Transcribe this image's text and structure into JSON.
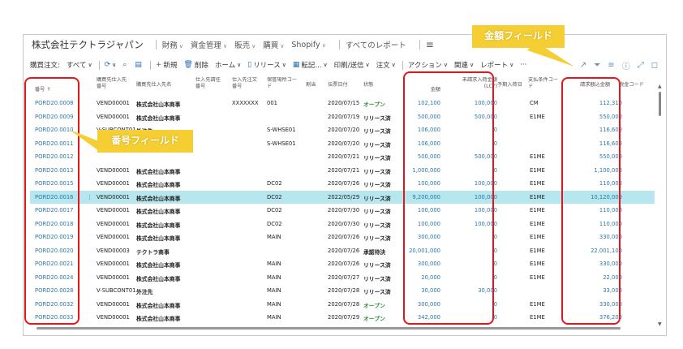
{
  "header": {
    "company": "株式会社テクトラジャパン",
    "nav": [
      {
        "label": "財務",
        "chev": true
      },
      {
        "label": "資金管理",
        "chev": true
      },
      {
        "label": "販売",
        "chev": true
      },
      {
        "label": "購買",
        "chev": true
      },
      {
        "label": "Shopify",
        "chev": true
      }
    ],
    "all_reports": "すべてのレポート",
    "menu_icon": "hamburger-icon"
  },
  "toolbar": {
    "title": "購買注文:",
    "filter": "すべて",
    "new": "新規",
    "delete": "削除",
    "home": "ホーム",
    "release": "リリース",
    "post": "転記...",
    "print": "印刷/送信",
    "order": "注文",
    "action": "アクション",
    "related": "関連",
    "report": "レポート",
    "more": "···"
  },
  "columns": {
    "no": "番号 ↑",
    "vendor_no": "購買先仕入先\n番号",
    "vendor_name": "購買先仕入先名",
    "pay_vendor_no": "仕入先請任\n番号",
    "vendor_order_no": "仕入先注文\n番号",
    "location": "保管場所コー\nド",
    "assign": "割当",
    "doc_date": "伝票日付",
    "status": "状態",
    "amount": "金額",
    "amount_lcy": "未請求入荷金額\n(LCY)",
    "receipt_date": "予期入荷日",
    "payment_terms": "支払条件コー\nド",
    "invoice_amount": "請求額込金額",
    "tax_code": "税金コード"
  },
  "rows": [
    {
      "no": "PORD20.0008",
      "vendor_no": "VEND00001",
      "vendor_name": "株式会社山本商事",
      "vendor_order_no": "XXXXXXX",
      "location": "001",
      "date": "2020/07/15",
      "status": "オープン",
      "status_type": "open",
      "amount": "102,100",
      "lcy": "100,000",
      "terms": "CM",
      "inv": "112,310"
    },
    {
      "no": "PORD20.0009",
      "vendor_no": "VEND00001",
      "vendor_name": "株式会社山本商事",
      "vendor_order_no": "",
      "location": "",
      "date": "2020/07/19",
      "status": "リリース済",
      "status_type": "rel",
      "amount": "500,000",
      "lcy": "500,000",
      "terms": "E1ME",
      "inv": "550,000"
    },
    {
      "no": "PORD20.0010",
      "vendor_no": "V-SUBCONT01",
      "vendor_name": "外注先",
      "vendor_order_no": "",
      "location": "S-WHSE01",
      "date": "2020/07/20",
      "status": "リリース済",
      "status_type": "rel",
      "amount": "106,000",
      "lcy": "0",
      "terms": "",
      "inv": "116,600"
    },
    {
      "no": "PORD20.0011",
      "vendor_no": "",
      "vendor_name": "",
      "vendor_order_no": "",
      "location": "S-WHSE01",
      "date": "2020/07/20",
      "status": "リリース済",
      "status_type": "rel",
      "amount": "106,000",
      "lcy": "0",
      "terms": "",
      "inv": "116,600"
    },
    {
      "no": "PORD20.0012",
      "vendor_no": "",
      "vendor_name": "",
      "vendor_order_no": "",
      "location": "",
      "date": "2020/07/21",
      "status": "リリース済",
      "status_type": "rel",
      "amount": "500,000",
      "lcy": "500,000",
      "terms": "E1ME",
      "inv": "550,000"
    },
    {
      "no": "PORD20.0013",
      "vendor_no": "VEND00001",
      "vendor_name": "株式会社山本商事",
      "vendor_order_no": "",
      "location": "",
      "date": "2020/07/21",
      "status": "リリース済",
      "status_type": "rel",
      "amount": "1,000,000",
      "lcy": "0",
      "terms": "E1ME",
      "inv": "1,100,000"
    },
    {
      "no": "PORD20.0015",
      "vendor_no": "VEND00001",
      "vendor_name": "株式会社山本商事",
      "vendor_order_no": "",
      "location": "DC02",
      "date": "2020/07/26",
      "status": "リリース済",
      "status_type": "rel",
      "amount": "100,000",
      "lcy": "100,000",
      "terms": "E1ME",
      "inv": "110,000"
    },
    {
      "no": "PORD20.0016",
      "vendor_no": "VEND00001",
      "vendor_name": "株式会社山本商事",
      "vendor_order_no": "",
      "location": "DC02",
      "date": "2022/05/29",
      "status": "リリース済",
      "status_type": "rel",
      "amount": "9,200,000",
      "lcy": "100,000",
      "terms": "E1ME",
      "inv": "10,120,000",
      "selected": true
    },
    {
      "no": "PORD20.0017",
      "vendor_no": "VEND00001",
      "vendor_name": "株式会社山本商事",
      "vendor_order_no": "",
      "location": "DC02",
      "date": "2020/07/30",
      "status": "リリース済",
      "status_type": "rel",
      "amount": "100,000",
      "lcy": "100,000",
      "terms": "E1ME",
      "inv": "110,000"
    },
    {
      "no": "PORD20.0018",
      "vendor_no": "VEND00001",
      "vendor_name": "株式会社山本商事",
      "vendor_order_no": "",
      "location": "DC02",
      "date": "2020/07/30",
      "status": "リリース済",
      "status_type": "rel",
      "amount": "100,000",
      "lcy": "100,000",
      "terms": "E1ME",
      "inv": "110,000"
    },
    {
      "no": "PORD20.0019",
      "vendor_no": "VEND00001",
      "vendor_name": "株式会社山本商事",
      "vendor_order_no": "",
      "location": "MAIN",
      "date": "2020/07/26",
      "status": "リリース済",
      "status_type": "rel",
      "amount": "300,000",
      "lcy": "0",
      "terms": "E1ME",
      "inv": "330,000"
    },
    {
      "no": "PORD20.0020",
      "vendor_no": "VEND00003",
      "vendor_name": "テクトラ商事",
      "vendor_order_no": "",
      "location": "",
      "date": "2020/07/26",
      "status": "承認待決",
      "status_type": "pend",
      "amount": "20,001,000",
      "lcy": "0",
      "terms": "E1ME",
      "inv": "22,001,100"
    },
    {
      "no": "PORD20.0021",
      "vendor_no": "VEND00001",
      "vendor_name": "株式会社山本商事",
      "vendor_order_no": "",
      "location": "MAIN",
      "date": "2020/07/26",
      "status": "リリース済",
      "status_type": "rel",
      "amount": "300,000",
      "lcy": "0",
      "terms": "E1ME",
      "inv": "330,000"
    },
    {
      "no": "PORD20.0024",
      "vendor_no": "VEND00001",
      "vendor_name": "株式会社山本商事",
      "vendor_order_no": "",
      "location": "MAIN",
      "date": "2020/07/27",
      "status": "リリース済",
      "status_type": "rel",
      "amount": "20,000",
      "lcy": "0",
      "terms": "E1ME",
      "inv": "22,000"
    },
    {
      "no": "PORD20.0028",
      "vendor_no": "V-SUBCONT01",
      "vendor_name": "外注先",
      "vendor_order_no": "",
      "location": "MAIN",
      "date": "2020/07/28",
      "status": "リリース済",
      "status_type": "rel",
      "amount": "30,000",
      "lcy": "30,000",
      "terms": "",
      "inv": "33,000"
    },
    {
      "no": "PORD20.0032",
      "vendor_no": "VEND00001",
      "vendor_name": "株式会社山本商事",
      "vendor_order_no": "",
      "location": "MAIN",
      "date": "2020/07/28",
      "status": "オープン",
      "status_type": "open",
      "amount": "300,000",
      "lcy": "0",
      "terms": "E1ME",
      "inv": "330,000"
    },
    {
      "no": "PORD20.0033",
      "vendor_no": "VEND00001",
      "vendor_name": "株式会社山本商事",
      "vendor_order_no": "",
      "location": "MAIN",
      "date": "2020/07/29",
      "status": "オープン",
      "status_type": "open",
      "amount": "342,000",
      "lcy": "0",
      "terms": "E1ME",
      "inv": "376,200"
    }
  ],
  "callouts": {
    "number_field": "番号フィールド",
    "amount_field": "金額フィールド"
  },
  "colors": {
    "callout_bg": "#f4ce32",
    "highlight_border": "#e8141b",
    "selected_row": "#b6e6ee",
    "link": "#2e77a8",
    "open_status": "#2e8b3a"
  }
}
